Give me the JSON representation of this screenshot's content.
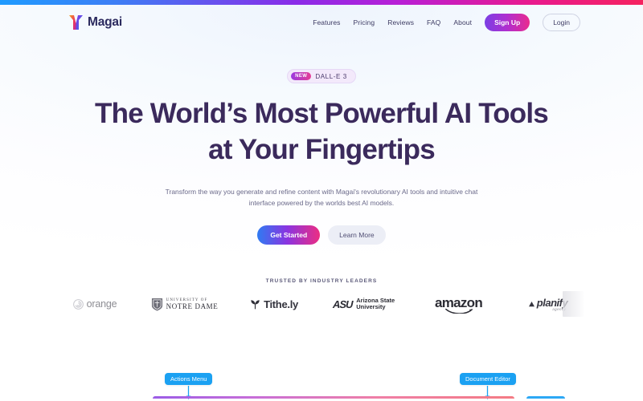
{
  "theme": {
    "accent_blue": "#1ba1f2",
    "brand_purple": "#8a2be8",
    "brand_pink": "#ea2a8e",
    "headline_color": "#3b2a5c",
    "top_strip_gradient": [
      "#1f9bff",
      "#8a2be8",
      "#f5225f"
    ]
  },
  "nav": {
    "brand": {
      "name": "Magai",
      "icon": "magai-m-logo-icon"
    },
    "links": [
      {
        "label": "Features"
      },
      {
        "label": "Pricing"
      },
      {
        "label": "Reviews"
      },
      {
        "label": "FAQ"
      },
      {
        "label": "About"
      }
    ],
    "signup_label": "Sign Up",
    "login_label": "Login"
  },
  "hero": {
    "badge": {
      "tag": "NEW",
      "text": "DALL-E 3"
    },
    "headline_line1": "The World’s Most Powerful AI Tools",
    "headline_line2": "at Your Fingertips",
    "subhead": "Transform the way you generate and refine content with Magai's revolutionary AI tools and intuitive chat interface powered by the worlds best AI models.",
    "primary_cta": "Get Started",
    "secondary_cta": "Learn More"
  },
  "trusted": {
    "label": "TRUSTED BY INDUSTRY LEADERS",
    "logos": [
      {
        "name": "orange",
        "text": "orange",
        "icon": "orange-spiral-icon"
      },
      {
        "name": "notre-dame",
        "line1": "UNIVERSITY OF",
        "line2": "NOTRE DAME",
        "icon": "notre-dame-shield-icon"
      },
      {
        "name": "tithely",
        "text": "Tithe.ly",
        "icon": "tithely-leaf-icon"
      },
      {
        "name": "arizona-state",
        "mark": "ASU",
        "line1": "Arizona State",
        "line2": "University"
      },
      {
        "name": "amazon",
        "text": "amazon",
        "icon": "amazon-smile-icon"
      },
      {
        "name": "planify",
        "text": "planify",
        "subtext": "agency",
        "icon": "planify-triangle-icon"
      }
    ]
  },
  "annotations": [
    {
      "label": "Actions Menu"
    },
    {
      "label": "Document Editor"
    }
  ]
}
